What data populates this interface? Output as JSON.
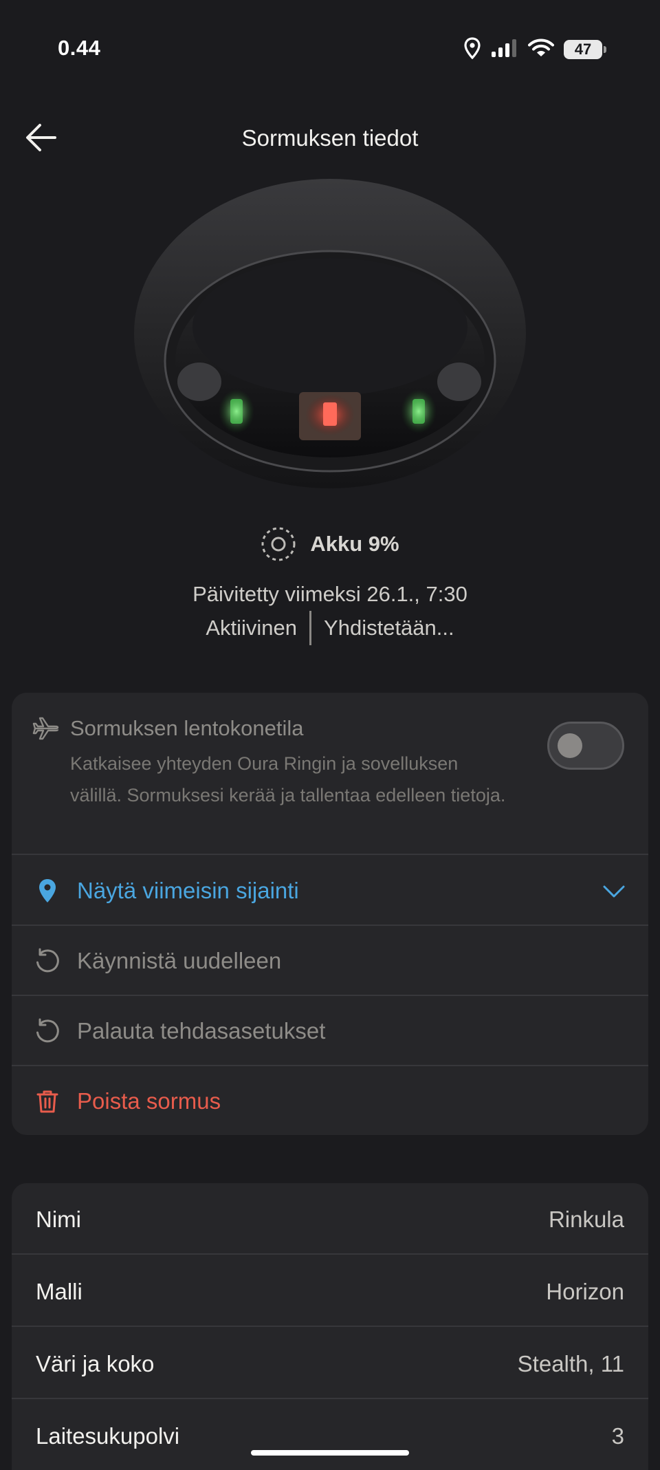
{
  "status_bar": {
    "time": "0.44",
    "battery_percent": "47"
  },
  "header": {
    "title": "Sormuksen tiedot",
    "back_icon": "arrow-left-icon"
  },
  "device": {
    "battery_label": "Akku 9%",
    "battery_level": 0.09,
    "updated": "Päivitetty viimeksi 26.1., 7:30",
    "state_primary": "Aktiivinen",
    "state_secondary": "Yhdistetään..."
  },
  "settings": {
    "airplane": {
      "icon": "airplane-icon",
      "title": "Sormuksen lentokonetila",
      "description": "Katkaisee yhteyden Oura Ringin ja sovelluksen välillä. Sormuksesi kerää ja tallentaa edelleen tietoja.",
      "enabled": false
    },
    "items": [
      {
        "label": "Näytä viimeisin sijainti",
        "icon": "location-pin-icon",
        "color": "#4aa6e0"
      },
      {
        "label": "Käynnistä uudelleen",
        "icon": "restart-icon",
        "color": "#8e8c88"
      },
      {
        "label": "Palauta tehdasasetukset",
        "icon": "restore-icon",
        "color": "#8e8c88"
      },
      {
        "label": "Poista sormus",
        "icon": "trash-icon",
        "color": "#e85c4c"
      }
    ]
  },
  "info": {
    "rows": [
      {
        "label": "Nimi",
        "value": "Rinkula"
      },
      {
        "label": "Malli",
        "value": "Horizon"
      },
      {
        "label": "Väri ja koko",
        "value": "Stealth, 11"
      },
      {
        "label": "Laitesukupolvi",
        "value": "3"
      }
    ]
  },
  "colors": {
    "background": "#1b1b1e",
    "card": "#262629",
    "accent_blue": "#4aa6e0",
    "danger_red": "#e85c4c"
  }
}
